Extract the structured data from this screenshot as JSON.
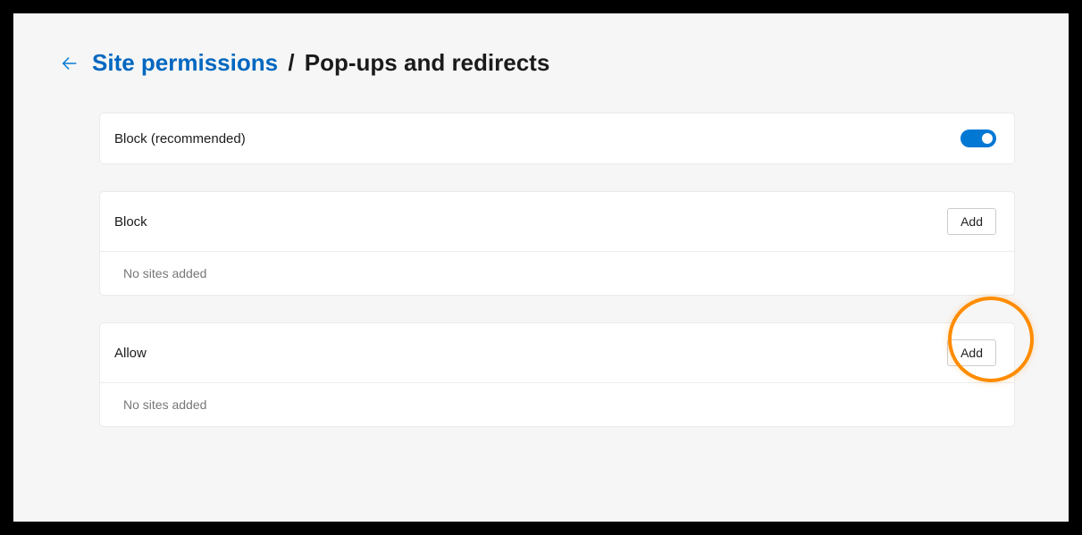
{
  "breadcrumb": {
    "parent": "Site permissions",
    "separator": "/",
    "current": "Pop-ups and redirects"
  },
  "blockRecommended": {
    "label": "Block (recommended)",
    "enabled": true
  },
  "blockSection": {
    "title": "Block",
    "addLabel": "Add",
    "emptyMessage": "No sites added"
  },
  "allowSection": {
    "title": "Allow",
    "addLabel": "Add",
    "emptyMessage": "No sites added"
  }
}
